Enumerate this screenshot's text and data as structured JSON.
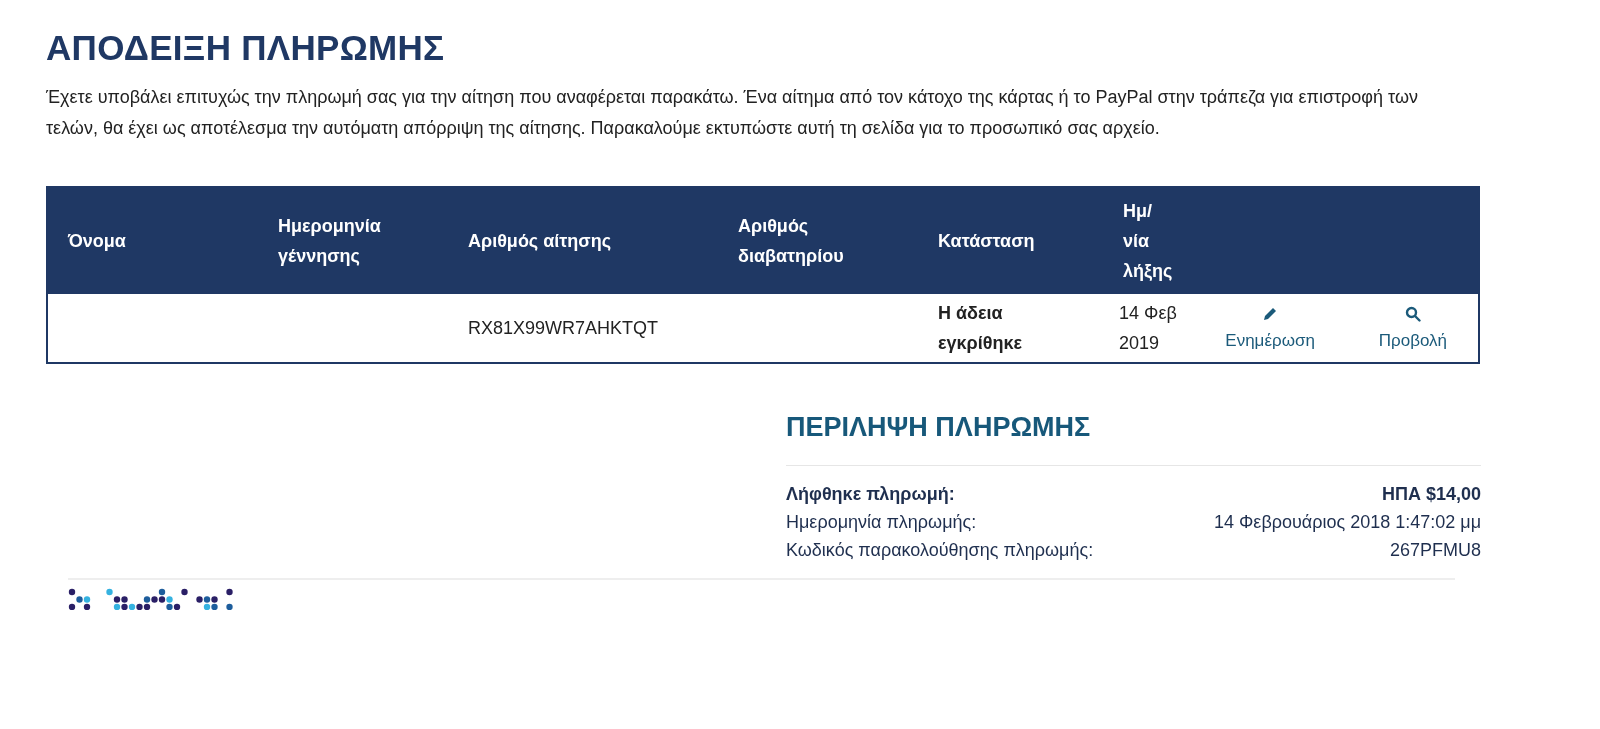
{
  "title": "ΑΠΟΔΕΙΞΗ ΠΛΗΡΩΜΗΣ",
  "intro": "Έχετε υποβάλει επιτυχώς την πληρωμή σας για την αίτηση που αναφέρεται παρακάτω. Ένα αίτημα από τον κάτοχο της κάρτας ή το PayPal στην τράπεζα για επιστροφή των τελών, θα έχει ως αποτέλεσμα την αυτόματη απόρριψη της αίτησης. Παρακαλούμε εκτυπώστε αυτή τη σελίδα για το προσωπικό σας αρχείο.",
  "table": {
    "columns": [
      "Όνομα",
      "Ημερομηνία γέννησης",
      "Αριθμός αίτησης",
      "Αριθμός διαβατηρίου",
      "Κατάσταση",
      "Ημ/ νία λήξης"
    ],
    "rows": [
      {
        "application_number": "RX81X99WR7AHKTQT",
        "status": "Η άδεια εγκρίθηκε",
        "expiry": "14 Φεβ 2019",
        "actions": [
          {
            "kind": "edit",
            "label": "Ενημέρωση"
          },
          {
            "kind": "view",
            "label": "Προβολή"
          }
        ]
      }
    ]
  },
  "summary": {
    "title": "ΠΕΡΙΛΗΨΗ ΠΛΗΡΩΜΗΣ",
    "rows": [
      {
        "label": "Λήφθηκε πληρωμή:",
        "value": "ΗΠΑ $14,00",
        "bold": true
      },
      {
        "label": "Ημερομηνία πληρωμής:",
        "value": "14 Φεβρουάριος 2018 1:47:02 μμ",
        "bold": false
      },
      {
        "label": "Κωδικός παρακολούθησης πληρωμής:",
        "value": "267PFMU8",
        "bold": false
      }
    ]
  }
}
